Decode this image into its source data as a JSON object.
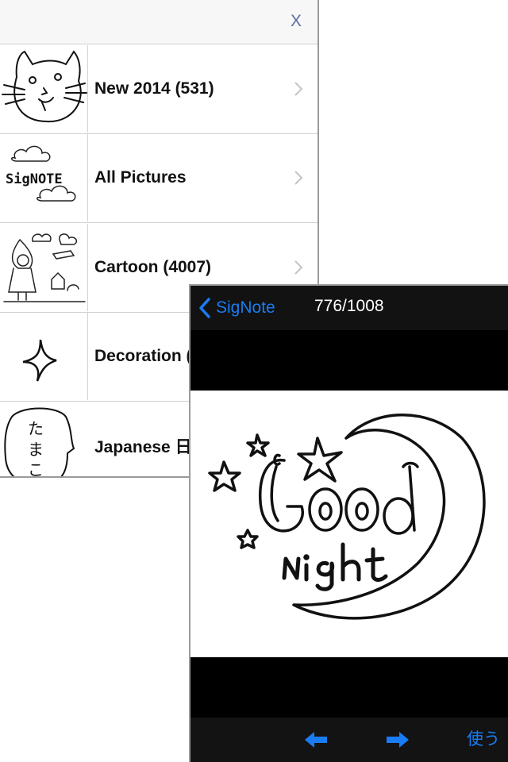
{
  "list": {
    "close_label": "X",
    "items": [
      {
        "label": "New 2014 (531)",
        "thumb": "cat-doodle"
      },
      {
        "label": "All Pictures",
        "thumb": "signote-logo-doodle"
      },
      {
        "label": "Cartoon (4007)",
        "thumb": "girl-clouds-doodle"
      },
      {
        "label": "Decoration (",
        "thumb": "sparkle-doodle"
      },
      {
        "label": "Japanese 日",
        "thumb": "speech-bubble-doodle"
      }
    ]
  },
  "viewer": {
    "back_label": "SigNote",
    "counter": "776/1008",
    "image": "good-night-moon-stars-drawing",
    "toolbar": {
      "prev_icon": "arrow-left-icon",
      "next_icon": "arrow-right-icon",
      "use_label": "使う"
    }
  },
  "colors": {
    "accent_blue": "#1a7cf2",
    "close_x": "#5a6fa0",
    "viewer_bg": "#000000",
    "nav_bg": "#121212"
  }
}
